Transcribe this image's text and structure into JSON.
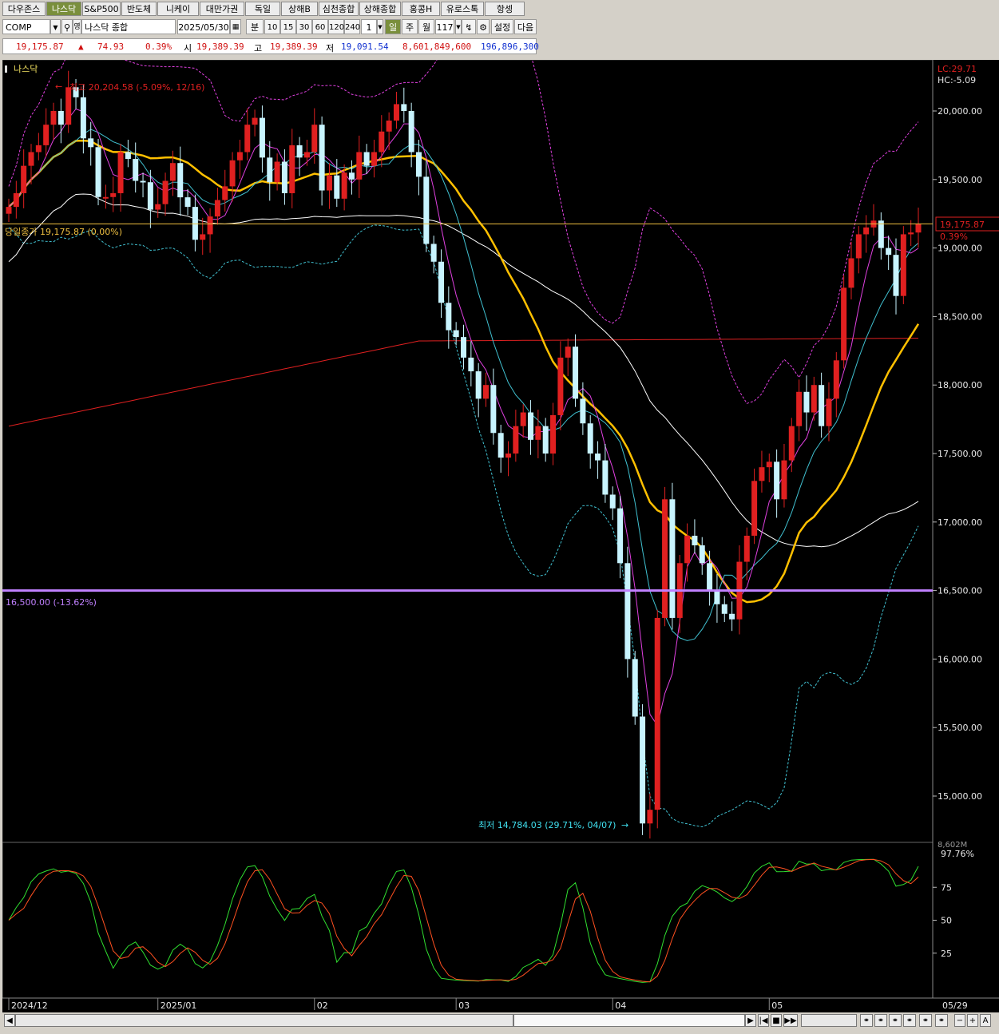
{
  "tabs": [
    "다우존스",
    "나스닥",
    "S&P500",
    "반도체",
    "니케이",
    "대만가권",
    "독일",
    "상해B",
    "심천종합",
    "상해종합",
    "홍콩H",
    "유로스톡",
    "항셍"
  ],
  "active_tab": 1,
  "toolbar": {
    "symbol": "COMP",
    "name": "나스닥 종합",
    "date": "2025/05/30",
    "unit_min": "분",
    "periods": [
      "10",
      "15",
      "30",
      "60",
      "120",
      "240"
    ],
    "period_input": "1",
    "day": "일",
    "week": "주",
    "month": "월",
    "count": "117",
    "settings": "설정",
    "next": "다음",
    "eng": "영"
  },
  "quote": {
    "price": "19,175.87",
    "arrow": "▲",
    "change": "74.93",
    "pct": "0.39%",
    "open_label": "시",
    "open": "19,389.39",
    "high_label": "고",
    "high": "19,389.39",
    "low_label": "저",
    "low": "19,091.54",
    "volume": "8,601,849,600",
    "amount": "196,896,300"
  },
  "chart": {
    "title": "나스닥",
    "high_note": "최고 20,204.58 (-5.09%, 12/16)",
    "low_note": "최저 14,784.03 (29.71%, 04/07)",
    "close_note": "당일종가 19,175.87 (0.00%)",
    "line_note": "16,500.00 (-13.62%)",
    "lc": "LC:29.71",
    "hc": "HC:-5.09",
    "price_tag": "19,175.87",
    "price_tag_pct": "0.39%",
    "vol_label": "8,602M",
    "stoch_top": "97.76%",
    "colors": {
      "up": "#e02020",
      "down": "#c8f4ff",
      "ma5": "#e040e0",
      "ma10": "#40c0d0",
      "ma20": "#ffc000",
      "ma60": "#ffffff",
      "ma120": "#e02020",
      "bb": "#e040e0",
      "bbl": "#40c0d0",
      "level": "#c080ff"
    }
  },
  "chart_data": {
    "type": "candlestick",
    "ylim": [
      14600,
      20600
    ],
    "y_ticks": [
      15000,
      15500,
      16000,
      16500,
      17000,
      17500,
      18000,
      18500,
      19000,
      19500,
      20000
    ],
    "y_tick_labels": [
      "15,000.00",
      "15,500.00",
      "16,000.00",
      "16,500.00",
      "17,000.00",
      "17,500.00",
      "18,000.00",
      "18,500.00",
      "19,000.00",
      "19,500.00",
      "20,000.00"
    ],
    "x_labels": [
      {
        "label": "2024/12",
        "index": 0
      },
      {
        "label": "2025/01",
        "index": 20
      },
      {
        "label": "02",
        "index": 41
      },
      {
        "label": "03",
        "index": 60
      },
      {
        "label": "04",
        "index": 81
      },
      {
        "label": "05",
        "index": 102
      }
    ],
    "last_date": "05/29",
    "closes": [
      19300,
      19400,
      19600,
      19700,
      19750,
      19900,
      20000,
      19900,
      20173,
      20100,
      19800,
      19736,
      19372,
      19372,
      19400,
      19700,
      19650,
      19490,
      19480,
      19280,
      19320,
      19490,
      19620,
      19370,
      19300,
      19060,
      19100,
      19230,
      19350,
      19450,
      19640,
      19700,
      19900,
      19950,
      19660,
      19480,
      19630,
      19400,
      19750,
      19660,
      19700,
      19900,
      19420,
      19530,
      19360,
      19550,
      19500,
      19700,
      19600,
      19700,
      19850,
      19930,
      20050,
      20000,
      19700,
      19520,
      19030,
      18900,
      18600,
      18400,
      18350,
      18200,
      18100,
      17900,
      18000,
      17650,
      17470,
      17500,
      17700,
      17800,
      17600,
      17700,
      17500,
      17780,
      18200,
      18280,
      17900,
      17720,
      17500,
      17450,
      17200,
      17100,
      16700,
      16000,
      15580,
      14800,
      14900,
      16300,
      17166,
      16300,
      16700,
      16900,
      16830,
      16700,
      16500,
      16400,
      16330,
      16290,
      16710,
      16900,
      17300,
      17400,
      17440,
      17166,
      17450,
      17700,
      17950,
      17800,
      18000,
      17700,
      17900,
      18180,
      18710,
      18925,
      19100,
      19150,
      19200,
      19000,
      18950,
      18650,
      19100,
      19113,
      19175
    ],
    "stochastic": {
      "top": "97.76%",
      "ticks": [
        25,
        50,
        75
      ]
    }
  },
  "bottom": {
    "left_arrow": "◀",
    "right_arrow": "▶",
    "controls": [
      "▶",
      "|◀",
      "■",
      "▶▶"
    ],
    "zoom_out": "−",
    "zoom_in": "+",
    "text_tool": "A"
  }
}
